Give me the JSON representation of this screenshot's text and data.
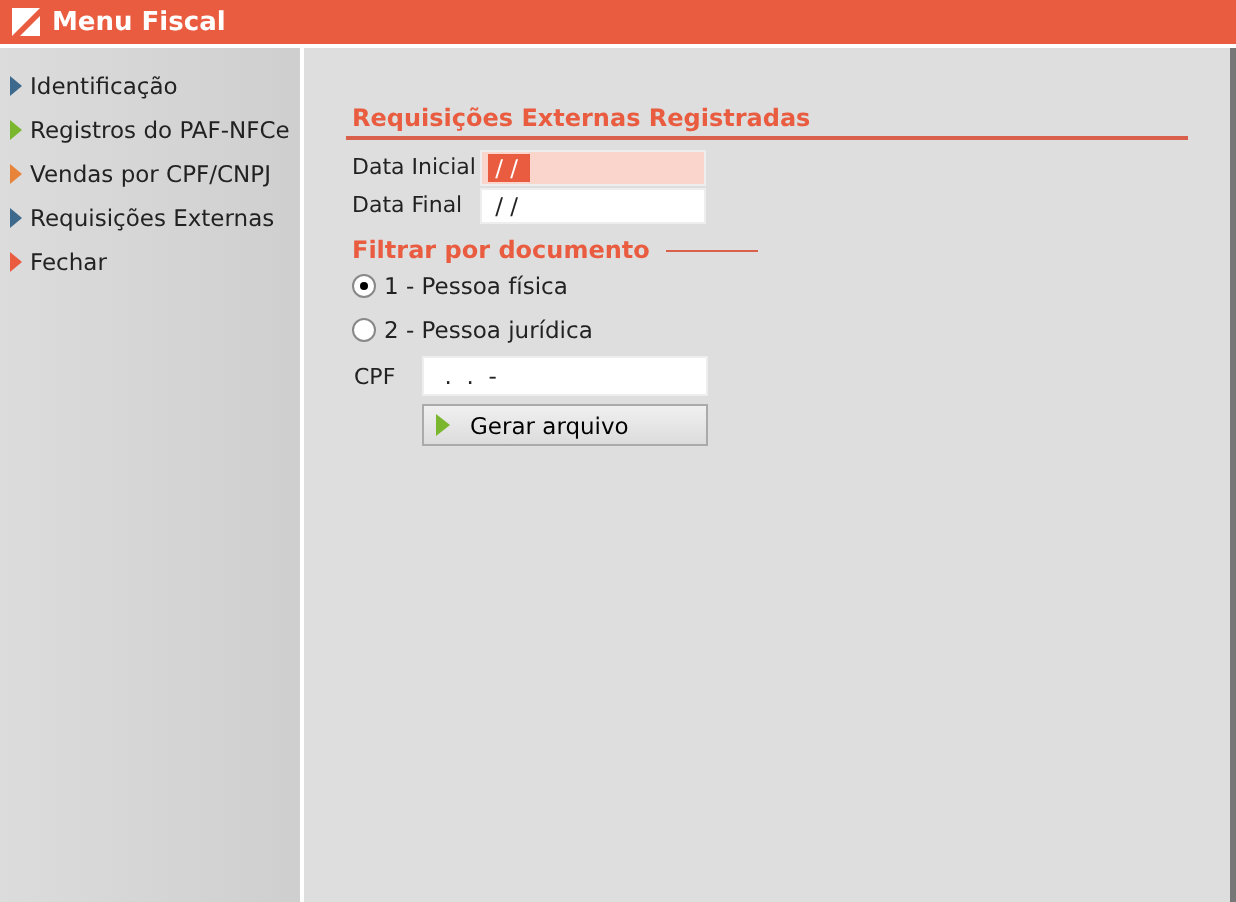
{
  "window": {
    "title": "Menu Fiscal"
  },
  "sidebar": {
    "items": [
      {
        "label": "Identificação",
        "color": "#3d6a8c"
      },
      {
        "label": "Registros do PAF-NFCe",
        "color": "#7ab62e"
      },
      {
        "label": "Vendas por CPF/CNPJ",
        "color": "#e8833a"
      },
      {
        "label": "Requisições Externas",
        "color": "#3d6a8c"
      },
      {
        "label": "Fechar",
        "color": "#e95c40"
      }
    ]
  },
  "panel": {
    "title": "Requisições Externas Registradas",
    "date_fields": [
      {
        "label": "Data Inicial",
        "value": " / /",
        "focused": true
      },
      {
        "label": "Data Final",
        "value": " / /",
        "focused": false
      }
    ],
    "filter": {
      "title": "Filtrar por documento",
      "options": [
        {
          "label": "1 - Pessoa física",
          "selected": true
        },
        {
          "label": "2 - Pessoa jurídica",
          "selected": false
        }
      ]
    },
    "document_field": {
      "label": "CPF",
      "value": "  .  .  -"
    },
    "button": "Gerar arquivo"
  }
}
